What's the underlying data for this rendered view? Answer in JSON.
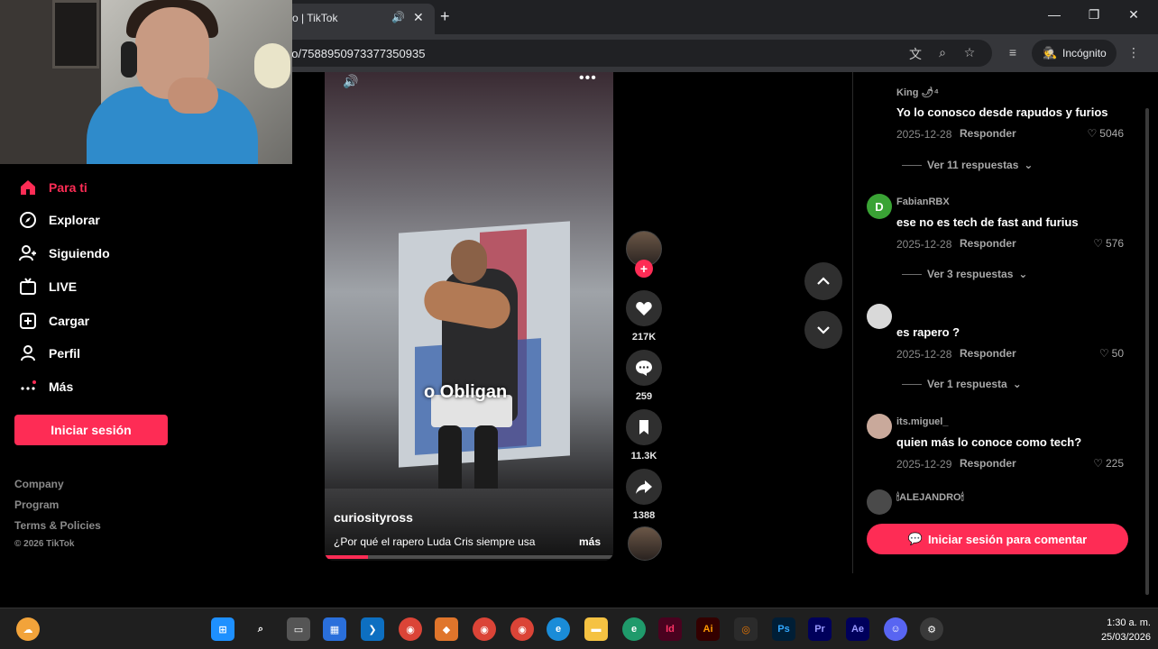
{
  "browser": {
    "tab_title": "o | TikTok",
    "url": "eo/7588950973377350935",
    "incognito_label": "Incógnito"
  },
  "sidebar": {
    "items": [
      {
        "label": "Para ti",
        "icon": "home-icon",
        "active": true
      },
      {
        "label": "Explorar",
        "icon": "compass-icon"
      },
      {
        "label": "Siguiendo",
        "icon": "following-icon"
      },
      {
        "label": "LIVE",
        "icon": "live-icon"
      },
      {
        "label": "Cargar",
        "icon": "upload-icon"
      },
      {
        "label": "Perfil",
        "icon": "profile-icon"
      },
      {
        "label": "Más",
        "icon": "more-icon"
      }
    ],
    "login_label": "Iniciar sesión",
    "footer": [
      "Company",
      "Program",
      "Terms & Policies"
    ],
    "copyright": "© 2026 TikTok"
  },
  "video": {
    "caption_overlay": "o Obligan",
    "author": "curiosityross",
    "description": "¿Por qué el rapero Luda Cris siempre usa",
    "more_label": "más",
    "progress": 0.15
  },
  "actions": {
    "likes": "217K",
    "comments": "259",
    "saves": "11.3K",
    "shares": "1388"
  },
  "comments": [
    {
      "user": "King 🌶⁴",
      "text": "Yo lo conosco desde rapudos y furios",
      "date": "2025-12-28",
      "reply": "Responder",
      "likes": "5046",
      "view_replies": "Ver 11 respuestas",
      "avatar_color": "#000000"
    },
    {
      "user": "FabianRBX",
      "text": "ese no es tech de fast and furius",
      "date": "2025-12-28",
      "reply": "Responder",
      "likes": "576",
      "view_replies": "Ver 3 respuestas",
      "avatar_color": "#3aa335",
      "avatar_letter": "D"
    },
    {
      "user": "",
      "text": "es rapero ?",
      "date": "2025-12-28",
      "reply": "Responder",
      "likes": "50",
      "view_replies": "Ver 1 respuesta",
      "avatar_color": "#d9d9d9"
    },
    {
      "user": "its.miguel_",
      "text": "quien más lo conoce como tech?",
      "date": "2025-12-29",
      "reply": "Responder",
      "likes": "225",
      "avatar_color": "#c9a99b"
    },
    {
      "user": "🕯ALEJANDRO🕯",
      "text": "",
      "avatar_color": "#4a4a4a"
    }
  ],
  "comment_login_label": "Iniciar sesión para comentar",
  "taskbar": {
    "time": "1:30 a. m.",
    "date": "25/03/2026"
  }
}
